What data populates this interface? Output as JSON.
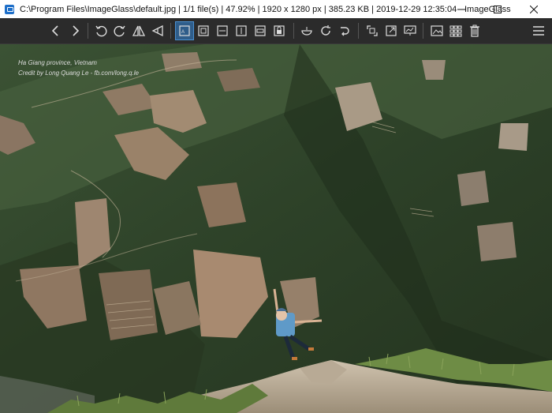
{
  "window": {
    "title": "C:\\Program Files\\ImageGlass\\default.jpg  |  1/1 file(s)  |  47.92%  |  1920 x 1280 px  |  385.23 KB  |  2019-12-29 12:35:04  - ImageGlass"
  },
  "toolbar": {
    "icons": [
      "chevron-left",
      "chevron-right",
      "rotate-left",
      "rotate-right",
      "flip-horizontal",
      "flip-vertical",
      "auto-zoom",
      "lock-zoom",
      "scale-width",
      "scale-height",
      "scale-to-fit",
      "fill",
      "crop",
      "open-with",
      "refresh",
      "go-to",
      "fullscreen-toggle",
      "frameless",
      "slideshow",
      "image-preview",
      "thumbnail-grid",
      "delete",
      "menu"
    ],
    "active": "auto-zoom"
  },
  "image": {
    "caption_line1": "Ha Giang province, Vietnam",
    "caption_line2": "Credit by Long Quang Le - fb.com/long.q.le"
  }
}
